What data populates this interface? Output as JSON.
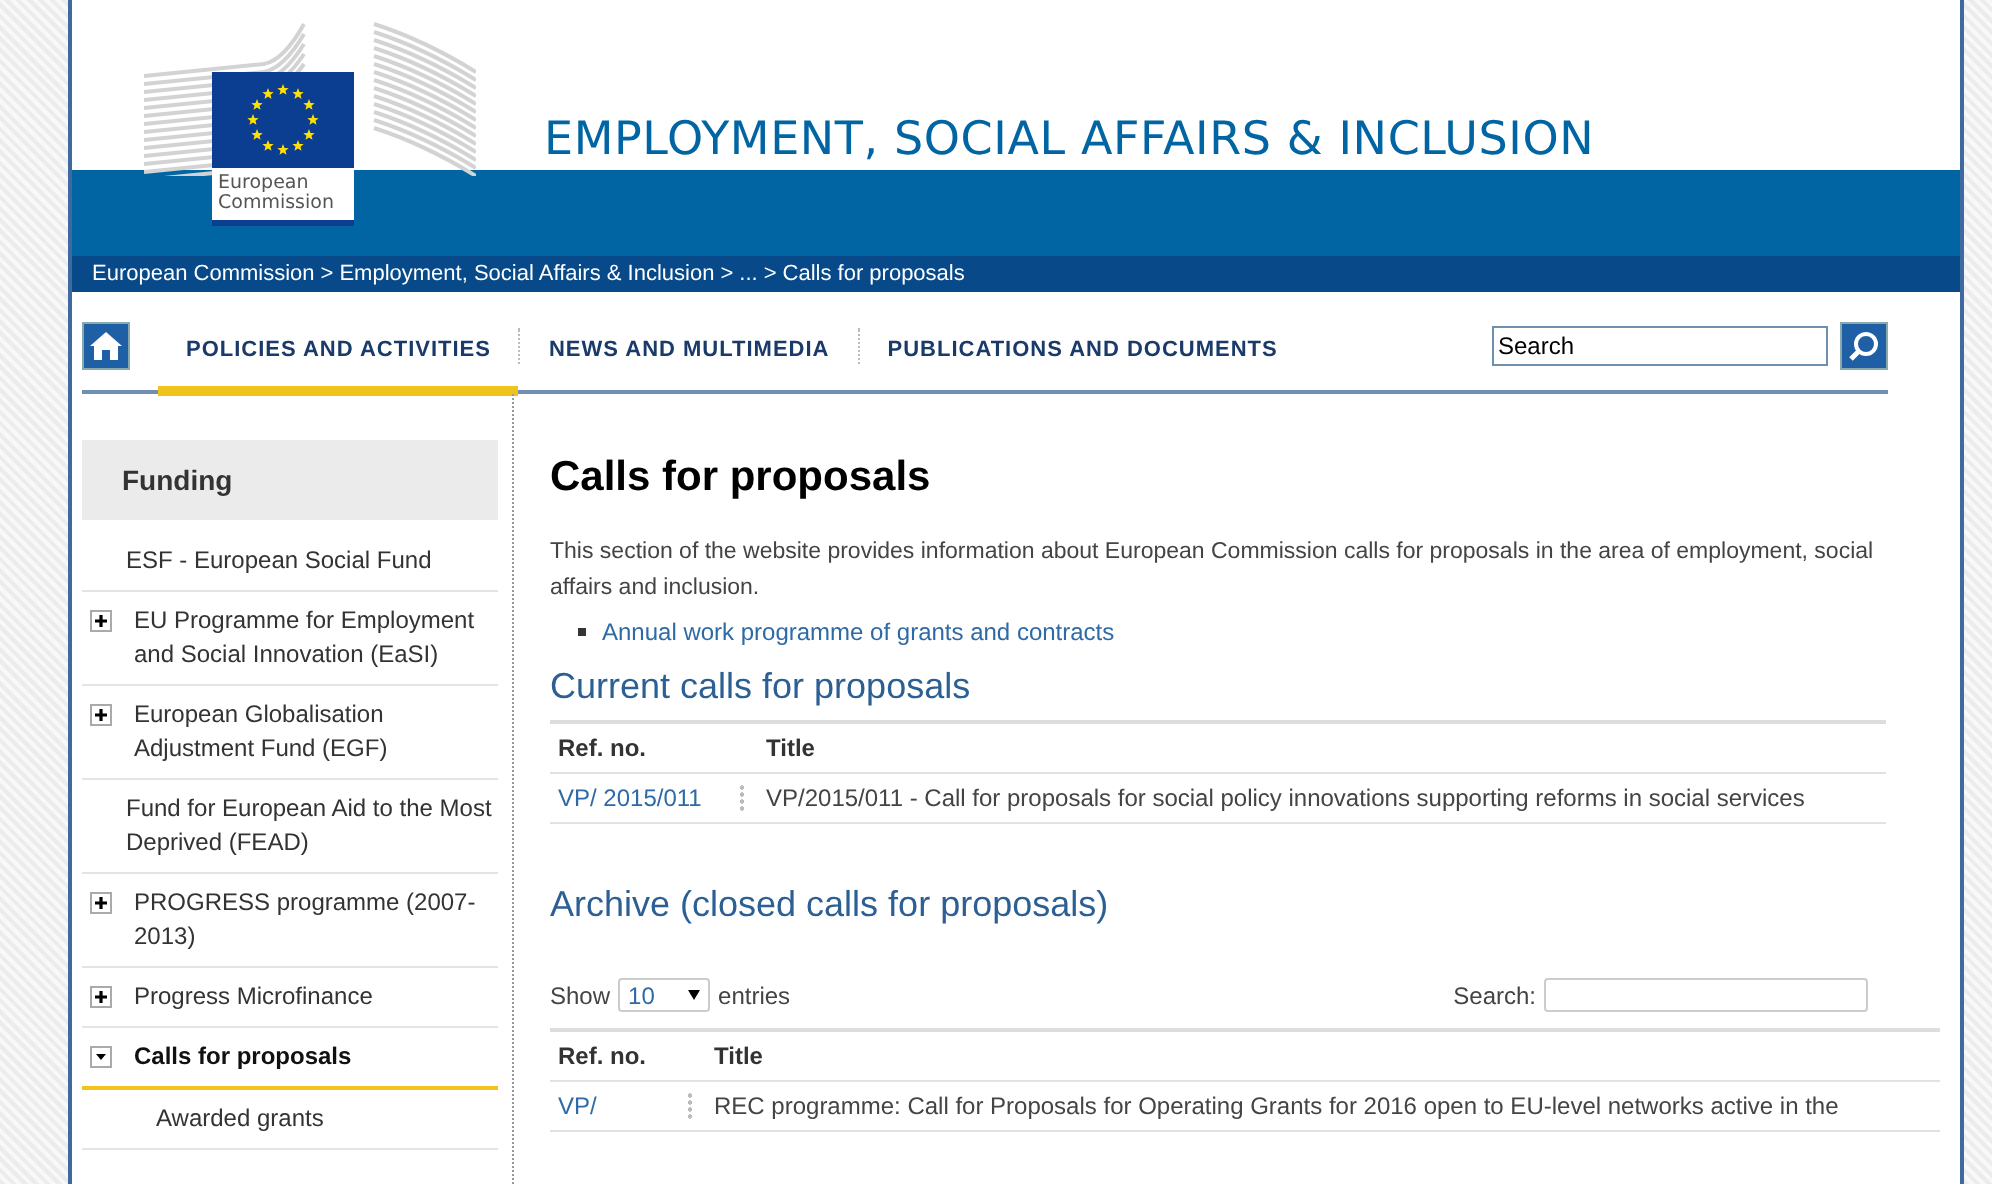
{
  "header": {
    "logo_text": "European Commission",
    "title": "EMPLOYMENT, SOCIAL AFFAIRS & INCLUSION"
  },
  "breadcrumb": [
    "European Commission",
    "Employment, Social Affairs & Inclusion",
    "...",
    "Calls for proposals"
  ],
  "breadcrumb_separator": ">",
  "nav": {
    "items": [
      {
        "label": "POLICIES AND ACTIVITIES",
        "selected": true
      },
      {
        "label": "NEWS AND MULTIMEDIA",
        "selected": false
      },
      {
        "label": "PUBLICATIONS AND DOCUMENTS",
        "selected": false
      }
    ],
    "search": {
      "placeholder": "Search"
    }
  },
  "sidebar": {
    "title": "Funding",
    "items": [
      {
        "label": "ESF - European Social Fund",
        "kind": "leaf",
        "selected": false
      },
      {
        "label": "EU Programme for Employment and Social Innovation (EaSI)",
        "kind": "branch",
        "expanded": false,
        "selected": false
      },
      {
        "label": "European Globalisation Adjustment Fund (EGF)",
        "kind": "branch",
        "expanded": false,
        "selected": false
      },
      {
        "label": "Fund for European Aid to the Most Deprived (FEAD)",
        "kind": "leaf",
        "selected": false
      },
      {
        "label": "PROGRESS programme (2007-2013)",
        "kind": "branch",
        "expanded": false,
        "selected": false
      },
      {
        "label": "Progress Microfinance",
        "kind": "branch",
        "expanded": false,
        "selected": false
      },
      {
        "label": "Calls for proposals",
        "kind": "branch",
        "expanded": true,
        "selected": true
      },
      {
        "label": "Awarded grants",
        "kind": "sub",
        "selected": false
      }
    ]
  },
  "content": {
    "title": "Calls for proposals",
    "intro": "This section of the website provides information about European Commission calls for proposals in the area of employment, social affairs and inclusion.",
    "links": [
      "Annual work programme of grants and contracts"
    ],
    "current": {
      "heading": "Current calls for proposals",
      "columns": [
        "Ref. no.",
        "Title"
      ],
      "rows": [
        {
          "ref": "VP/ 2015/011",
          "title": "VP/2015/011 - Call for proposals for social policy innovations supporting reforms in social services"
        }
      ]
    },
    "archive": {
      "heading": "Archive (closed calls for proposals)",
      "show_label": "Show",
      "page_size": "10",
      "entries_label": "entries",
      "search_label": "Search:",
      "columns": [
        "Ref. no.",
        "Title"
      ],
      "rows": [
        {
          "ref": "VP/",
          "title": "REC programme: Call for Proposals for Operating Grants for 2016 open to EU-level networks active in the"
        }
      ]
    }
  }
}
